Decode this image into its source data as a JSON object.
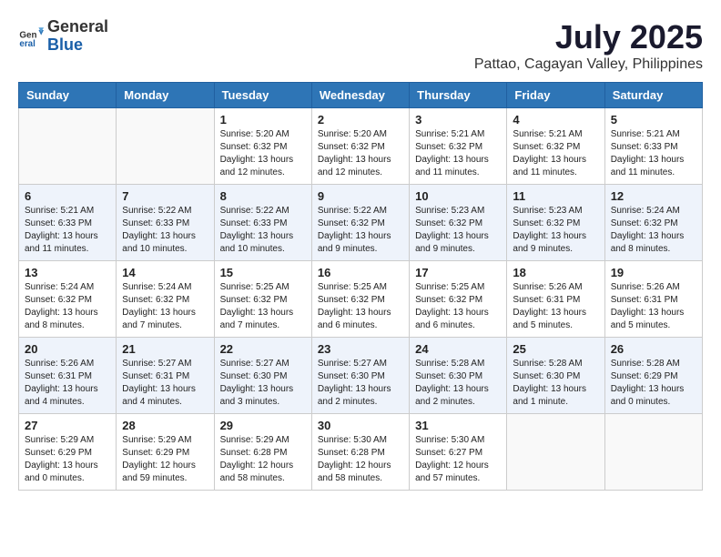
{
  "logo": {
    "text_general": "General",
    "text_blue": "Blue"
  },
  "title": "July 2025",
  "location": "Pattao, Cagayan Valley, Philippines",
  "days_of_week": [
    "Sunday",
    "Monday",
    "Tuesday",
    "Wednesday",
    "Thursday",
    "Friday",
    "Saturday"
  ],
  "weeks": [
    [
      {
        "day": "",
        "info": ""
      },
      {
        "day": "",
        "info": ""
      },
      {
        "day": "1",
        "info": "Sunrise: 5:20 AM\nSunset: 6:32 PM\nDaylight: 13 hours and 12 minutes."
      },
      {
        "day": "2",
        "info": "Sunrise: 5:20 AM\nSunset: 6:32 PM\nDaylight: 13 hours and 12 minutes."
      },
      {
        "day": "3",
        "info": "Sunrise: 5:21 AM\nSunset: 6:32 PM\nDaylight: 13 hours and 11 minutes."
      },
      {
        "day": "4",
        "info": "Sunrise: 5:21 AM\nSunset: 6:32 PM\nDaylight: 13 hours and 11 minutes."
      },
      {
        "day": "5",
        "info": "Sunrise: 5:21 AM\nSunset: 6:33 PM\nDaylight: 13 hours and 11 minutes."
      }
    ],
    [
      {
        "day": "6",
        "info": "Sunrise: 5:21 AM\nSunset: 6:33 PM\nDaylight: 13 hours and 11 minutes."
      },
      {
        "day": "7",
        "info": "Sunrise: 5:22 AM\nSunset: 6:33 PM\nDaylight: 13 hours and 10 minutes."
      },
      {
        "day": "8",
        "info": "Sunrise: 5:22 AM\nSunset: 6:33 PM\nDaylight: 13 hours and 10 minutes."
      },
      {
        "day": "9",
        "info": "Sunrise: 5:22 AM\nSunset: 6:32 PM\nDaylight: 13 hours and 9 minutes."
      },
      {
        "day": "10",
        "info": "Sunrise: 5:23 AM\nSunset: 6:32 PM\nDaylight: 13 hours and 9 minutes."
      },
      {
        "day": "11",
        "info": "Sunrise: 5:23 AM\nSunset: 6:32 PM\nDaylight: 13 hours and 9 minutes."
      },
      {
        "day": "12",
        "info": "Sunrise: 5:24 AM\nSunset: 6:32 PM\nDaylight: 13 hours and 8 minutes."
      }
    ],
    [
      {
        "day": "13",
        "info": "Sunrise: 5:24 AM\nSunset: 6:32 PM\nDaylight: 13 hours and 8 minutes."
      },
      {
        "day": "14",
        "info": "Sunrise: 5:24 AM\nSunset: 6:32 PM\nDaylight: 13 hours and 7 minutes."
      },
      {
        "day": "15",
        "info": "Sunrise: 5:25 AM\nSunset: 6:32 PM\nDaylight: 13 hours and 7 minutes."
      },
      {
        "day": "16",
        "info": "Sunrise: 5:25 AM\nSunset: 6:32 PM\nDaylight: 13 hours and 6 minutes."
      },
      {
        "day": "17",
        "info": "Sunrise: 5:25 AM\nSunset: 6:32 PM\nDaylight: 13 hours and 6 minutes."
      },
      {
        "day": "18",
        "info": "Sunrise: 5:26 AM\nSunset: 6:31 PM\nDaylight: 13 hours and 5 minutes."
      },
      {
        "day": "19",
        "info": "Sunrise: 5:26 AM\nSunset: 6:31 PM\nDaylight: 13 hours and 5 minutes."
      }
    ],
    [
      {
        "day": "20",
        "info": "Sunrise: 5:26 AM\nSunset: 6:31 PM\nDaylight: 13 hours and 4 minutes."
      },
      {
        "day": "21",
        "info": "Sunrise: 5:27 AM\nSunset: 6:31 PM\nDaylight: 13 hours and 4 minutes."
      },
      {
        "day": "22",
        "info": "Sunrise: 5:27 AM\nSunset: 6:30 PM\nDaylight: 13 hours and 3 minutes."
      },
      {
        "day": "23",
        "info": "Sunrise: 5:27 AM\nSunset: 6:30 PM\nDaylight: 13 hours and 2 minutes."
      },
      {
        "day": "24",
        "info": "Sunrise: 5:28 AM\nSunset: 6:30 PM\nDaylight: 13 hours and 2 minutes."
      },
      {
        "day": "25",
        "info": "Sunrise: 5:28 AM\nSunset: 6:30 PM\nDaylight: 13 hours and 1 minute."
      },
      {
        "day": "26",
        "info": "Sunrise: 5:28 AM\nSunset: 6:29 PM\nDaylight: 13 hours and 0 minutes."
      }
    ],
    [
      {
        "day": "27",
        "info": "Sunrise: 5:29 AM\nSunset: 6:29 PM\nDaylight: 13 hours and 0 minutes."
      },
      {
        "day": "28",
        "info": "Sunrise: 5:29 AM\nSunset: 6:29 PM\nDaylight: 12 hours and 59 minutes."
      },
      {
        "day": "29",
        "info": "Sunrise: 5:29 AM\nSunset: 6:28 PM\nDaylight: 12 hours and 58 minutes."
      },
      {
        "day": "30",
        "info": "Sunrise: 5:30 AM\nSunset: 6:28 PM\nDaylight: 12 hours and 58 minutes."
      },
      {
        "day": "31",
        "info": "Sunrise: 5:30 AM\nSunset: 6:27 PM\nDaylight: 12 hours and 57 minutes."
      },
      {
        "day": "",
        "info": ""
      },
      {
        "day": "",
        "info": ""
      }
    ]
  ]
}
